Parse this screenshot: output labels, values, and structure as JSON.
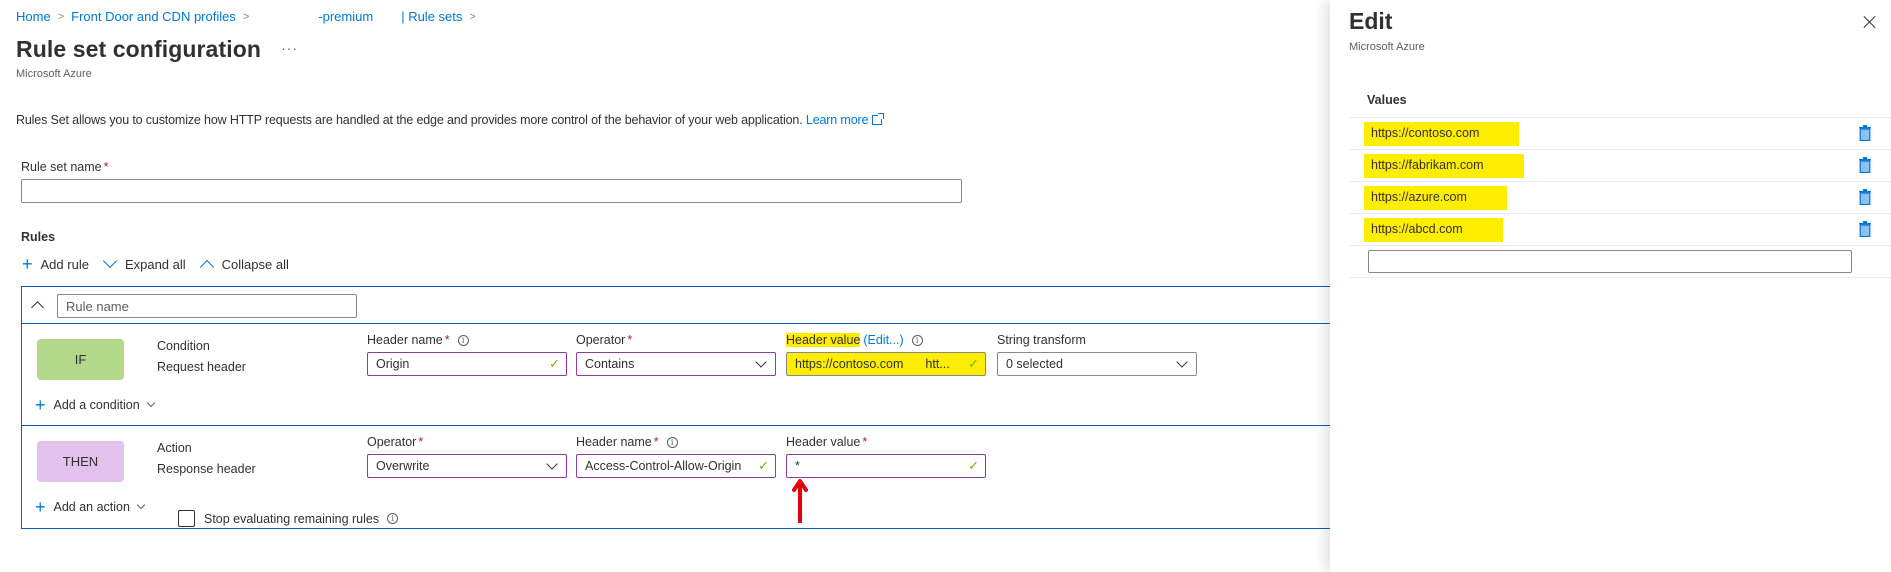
{
  "breadcrumb": {
    "items": [
      "Home",
      "Front Door and CDN profiles",
      "-premium",
      "| Rule sets"
    ]
  },
  "header": {
    "title": "Rule set configuration",
    "more": "···",
    "subtitle": "Microsoft Azure"
  },
  "description": {
    "text": "Rules Set allows you to customize how HTTP requests are handled at the edge and provides more control of the behavior of your web application.",
    "learn_more": "Learn more"
  },
  "rule_set_name": {
    "label": "Rule set name",
    "required": "*",
    "value": ""
  },
  "rules": {
    "label": "Rules",
    "toolbar": {
      "add_rule": "Add rule",
      "expand_all": "Expand all",
      "collapse_all": "Collapse all"
    },
    "rule": {
      "name_placeholder": "Rule name",
      "condition": {
        "badge": "IF",
        "kind_title": "Condition",
        "kind_value": "Request header",
        "header_name_label": "Header name",
        "header_name_value": "Origin",
        "operator_label": "Operator",
        "operator_value": "Contains",
        "header_value_label": "Header value",
        "header_value_edit": "(Edit...)",
        "header_value_value": "https://contoso.com",
        "header_value_more": "htt...",
        "string_transform_label": "String transform",
        "string_transform_value": "0 selected",
        "add_condition": "Add a condition"
      },
      "action": {
        "badge": "THEN",
        "kind_title": "Action",
        "kind_value": "Response header",
        "operator_label": "Operator",
        "operator_value": "Overwrite",
        "header_name_label": "Header name",
        "header_name_value": "Access-Control-Allow-Origin",
        "header_value_label": "Header value",
        "header_value_value": "*",
        "add_action": "Add an action",
        "stop_evaluating": "Stop evaluating remaining rules",
        "stop_evaluating_checked": false
      }
    }
  },
  "edit_panel": {
    "title": "Edit",
    "subtitle": "Microsoft Azure",
    "values_header": "Values",
    "values": [
      "https://contoso.com",
      "https://fabrikam.com",
      "https://azure.com",
      "https://abcd.com"
    ],
    "new_value": ""
  },
  "colors": {
    "accent": "#0078d4",
    "card_border": "#0f5bb5",
    "if_badge": "#b2d98a",
    "then_badge": "#e2c1ec",
    "highlight": "#ffed00",
    "valid_border": "#8a3c9f",
    "check": "#6bb700",
    "annotation_arrow": "#e3000f"
  }
}
